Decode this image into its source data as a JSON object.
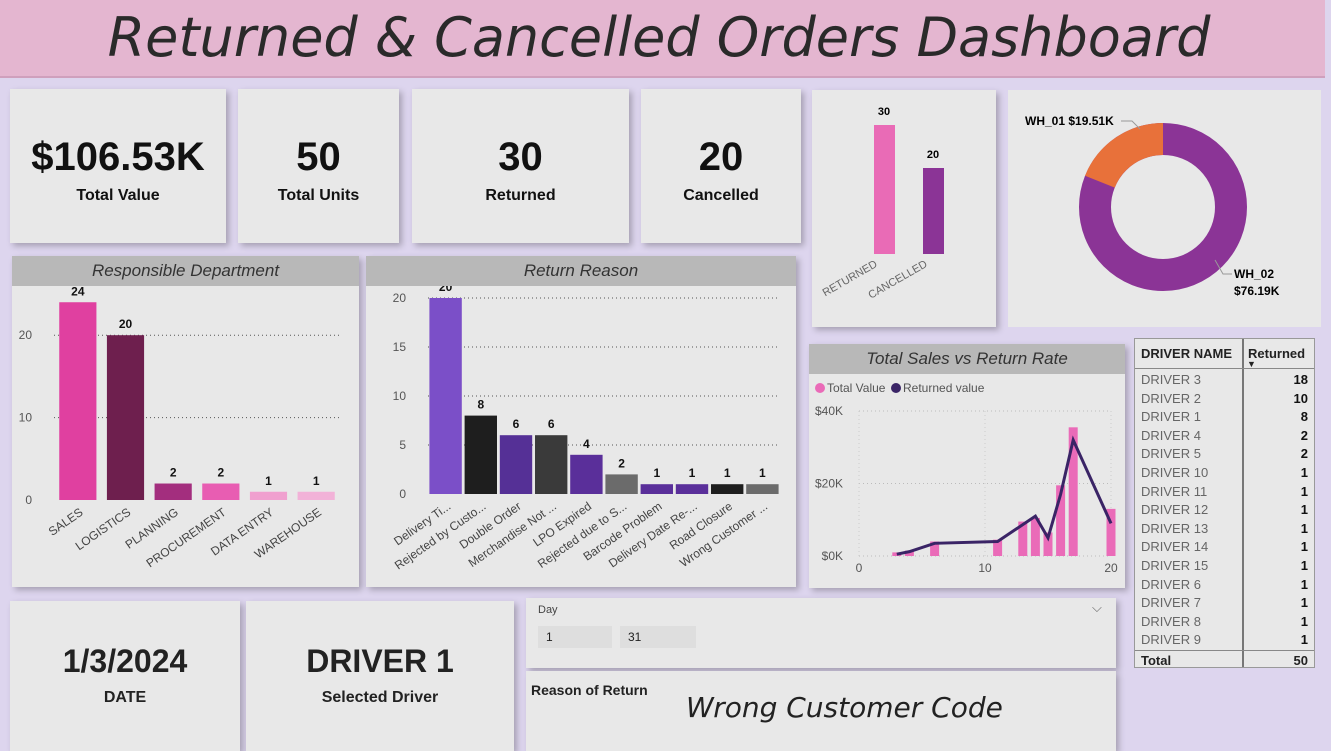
{
  "title": "Returned & Cancelled Orders Dashboard",
  "kpis": [
    {
      "value": "$106.53K",
      "label": "Total Value"
    },
    {
      "value": "50",
      "label": "Total Units"
    },
    {
      "value": "30",
      "label": "Returned"
    },
    {
      "value": "20",
      "label": "Cancelled"
    }
  ],
  "colors": {
    "pink": "#e05aa8",
    "purple": "#8a3a9a",
    "orange": "#e8713a",
    "violet": "#7a4fc6",
    "dark": "#1e1e1e"
  },
  "chart_data": [
    {
      "type": "bar",
      "name_hint": "returned-cancelled",
      "categories": [
        "RETURNED",
        "CANCELLED"
      ],
      "values": [
        30,
        20
      ],
      "colors": [
        "#e96bb6",
        "#8b3496"
      ]
    },
    {
      "type": "pie",
      "donut": true,
      "slices": [
        {
          "label": "WH_01",
          "value_label": "$19.51K",
          "value": 19.51,
          "color": "#e8713a"
        },
        {
          "label": "WH_02",
          "value_label": "$76.19K",
          "value": 76.19,
          "color": "#8b3496"
        }
      ]
    },
    {
      "type": "bar",
      "title": "Responsible Department",
      "categories": [
        "SALES",
        "LOGISTICS",
        "PLANNING",
        "PROCUREMENT",
        "DATA ENTRY",
        "WAREHOUSE"
      ],
      "values": [
        24,
        20,
        2,
        2,
        1,
        1
      ],
      "colors": [
        "#e040a0",
        "#6e1f4e",
        "#a32e7e",
        "#e85db2",
        "#f0a0cf",
        "#f2b2d8"
      ],
      "yticks": [
        0,
        10,
        20
      ],
      "ylim": [
        0,
        25
      ]
    },
    {
      "type": "bar",
      "title": "Return Reason",
      "categories": [
        "Delivery Ti...",
        "Rejected by Custo...",
        "Double Order",
        "Merchandise Not ...",
        "LPO Expired",
        "Rejected due to S...",
        "Barcode Problem",
        "Delivery Date Re-...",
        "Road Closure",
        "Wrong Customer ..."
      ],
      "values": [
        20,
        8,
        6,
        6,
        4,
        2,
        1,
        1,
        1,
        1
      ],
      "colors": [
        "#7b4fc8",
        "#1e1e1e",
        "#553096",
        "#3a3a3a",
        "#5a2f9a",
        "#6b6b6b",
        "#5a2f9a",
        "#5a2f9a",
        "#1e1e1e",
        "#6b6b6b"
      ],
      "yticks": [
        0,
        5,
        10,
        15,
        20
      ],
      "ylim": [
        0,
        20
      ]
    },
    {
      "type": "line",
      "title": "Total Sales vs Return Rate",
      "series": [
        {
          "name": "Total Value",
          "kind": "bar",
          "color": "#ea6bb8",
          "x": [
            3,
            4,
            6,
            11,
            13,
            14,
            15,
            16,
            17,
            20
          ],
          "values": [
            1000,
            1500,
            4000,
            4500,
            9500,
            10500,
            6500,
            19500,
            35500,
            13000
          ]
        },
        {
          "name": "Returned value",
          "kind": "line",
          "color": "#3a2466",
          "x": [
            3,
            4,
            6,
            11,
            14,
            15,
            16,
            17,
            20
          ],
          "values": [
            500,
            1200,
            3500,
            4000,
            11000,
            5000,
            17000,
            32000,
            9000
          ]
        }
      ],
      "xticks": [
        0,
        10,
        20
      ],
      "yticks": [
        "$0K",
        "$20K",
        "$40K"
      ],
      "xlim": [
        0,
        20
      ],
      "ylim": [
        0,
        40000
      ]
    }
  ],
  "drivers": {
    "col1": "DRIVER NAME",
    "col2": "Returned",
    "rows": [
      {
        "name": "DRIVER 3",
        "value": "18"
      },
      {
        "name": "DRIVER 2",
        "value": "10"
      },
      {
        "name": "DRIVER 1",
        "value": "8"
      },
      {
        "name": "DRIVER 4",
        "value": "2"
      },
      {
        "name": "DRIVER 5",
        "value": "2"
      },
      {
        "name": "DRIVER 10",
        "value": "1"
      },
      {
        "name": "DRIVER 11",
        "value": "1"
      },
      {
        "name": "DRIVER 12",
        "value": "1"
      },
      {
        "name": "DRIVER 13",
        "value": "1"
      },
      {
        "name": "DRIVER 14",
        "value": "1"
      },
      {
        "name": "DRIVER 15",
        "value": "1"
      },
      {
        "name": "DRIVER 6",
        "value": "1"
      },
      {
        "name": "DRIVER 7",
        "value": "1"
      },
      {
        "name": "DRIVER 8",
        "value": "1"
      },
      {
        "name": "DRIVER 9",
        "value": "1"
      }
    ],
    "total_label": "Total",
    "total_value": "50"
  },
  "date_card": {
    "value": "1/3/2024",
    "label": "DATE"
  },
  "driver_card": {
    "value": "DRIVER 1",
    "label": "Selected Driver"
  },
  "day_slicer": {
    "label": "Day",
    "from": "1",
    "to": "31"
  },
  "reason_card": {
    "label": "Reason of Return",
    "value": "Wrong Customer Code"
  }
}
